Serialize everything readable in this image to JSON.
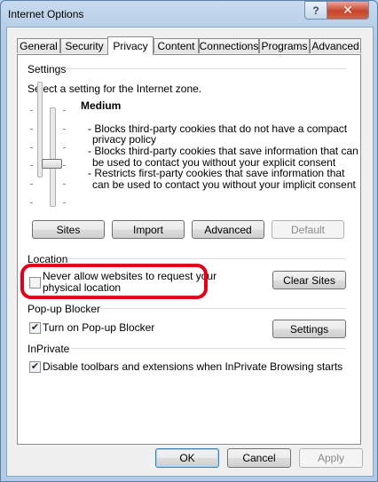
{
  "window": {
    "title": "Internet Options",
    "help_label": "?",
    "close_label": "✕"
  },
  "tabs": [
    {
      "label": "General"
    },
    {
      "label": "Security"
    },
    {
      "label": "Privacy"
    },
    {
      "label": "Content"
    },
    {
      "label": "Connections"
    },
    {
      "label": "Programs"
    },
    {
      "label": "Advanced"
    }
  ],
  "settings": {
    "title": "Settings",
    "zone_text": "Select a setting for the Internet zone.",
    "level": "Medium",
    "desc1a": "- Blocks third-party cookies that do not have a compact",
    "desc1b": "privacy policy",
    "desc2a": "- Blocks third-party cookies that save information that can",
    "desc2b": "be used to contact you without your explicit consent",
    "desc3a": "- Restricts first-party cookies that save information that",
    "desc3b": "can be used to contact you without your implicit consent",
    "buttons": {
      "sites": "Sites",
      "import": "Import",
      "advanced": "Advanced",
      "default": "Default"
    }
  },
  "location": {
    "title": "Location",
    "checkbox_line1": "Never allow websites to request your",
    "checkbox_line2": "physical location",
    "checked": false,
    "clear_sites": "Clear Sites"
  },
  "popup": {
    "title": "Pop-up Blocker",
    "checkbox_label": "Turn on Pop-up Blocker",
    "checked": true,
    "settings_button": "Settings"
  },
  "inprivate": {
    "title": "InPrivate",
    "checkbox_label": "Disable toolbars and extensions when InPrivate Browsing starts",
    "checked": true
  },
  "footer": {
    "ok": "OK",
    "cancel": "Cancel",
    "apply": "Apply"
  },
  "check_mark": "✔",
  "colors": {
    "highlight": "#e0001b",
    "close_button": "#c7432a"
  }
}
